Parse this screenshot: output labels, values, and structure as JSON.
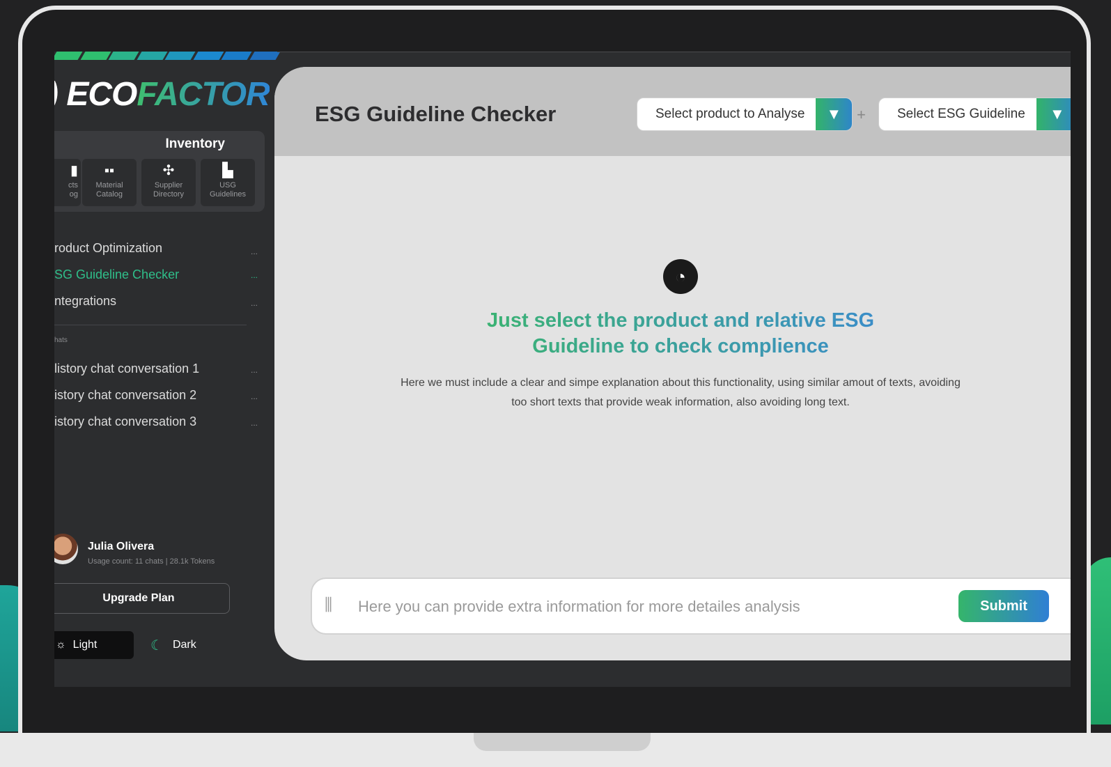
{
  "brand": {
    "eco": "ECO",
    "factor": "FACTOR"
  },
  "stripe_colors": [
    "#2fbf6f",
    "#2fbf6f",
    "#2bb38a",
    "#25a6a4",
    "#1f97bd",
    "#1b89cf",
    "#1a7cc9",
    "#1f6fbf"
  ],
  "inventory": {
    "title": "Inventory",
    "tiles": [
      {
        "icon": "products-catalog-icon",
        "label": "cts\nog"
      },
      {
        "icon": "grid-icon",
        "label": "Material\nCatalog"
      },
      {
        "icon": "supplier-network-icon",
        "label": "Supplier\nDirectory"
      },
      {
        "icon": "bookmark-icon",
        "label": "USG\nGuidelines"
      }
    ]
  },
  "nav": {
    "items": [
      {
        "label": "roduct Optimization",
        "more": "...",
        "active": false
      },
      {
        "label": "SG Guideline Checker",
        "more": "...",
        "active": true
      },
      {
        "label": "ntegrations",
        "more": "...",
        "active": false
      }
    ],
    "section_label": "hats",
    "chats": [
      {
        "label": "listory chat conversation 1",
        "more": "..."
      },
      {
        "label": "istory chat conversation 2",
        "more": "..."
      },
      {
        "label": "istory chat conversation 3",
        "more": "..."
      }
    ]
  },
  "user": {
    "name": "Julia Olivera",
    "usage": "Usage count: 11 chats | 28.1k Tokens"
  },
  "upgrade_label": "Upgrade Plan",
  "theme": {
    "light": "Light",
    "dark": "Dark"
  },
  "header": {
    "title": "ESG Guideline Checker",
    "product_select": "Select product to Analyse",
    "guideline_select": "Select ESG Guideline",
    "plus": "+"
  },
  "empty_state": {
    "headline": "Just select the product and relative ESG Guideline to check complience",
    "description": "Here we must include a clear and simpe explanation about this functionality, using similar amout of texts, avoiding too short texts that provide weak information, also avoiding long text."
  },
  "prompt": {
    "placeholder": "Here you can provide extra information for more detailes analysis",
    "submit": "Submit"
  }
}
